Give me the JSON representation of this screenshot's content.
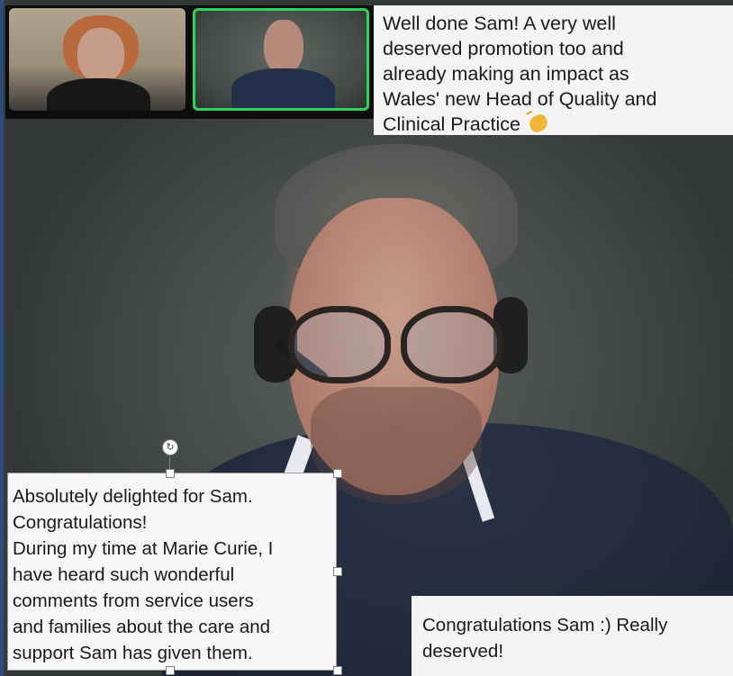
{
  "participants": [
    {
      "name": "",
      "role": "thumbnail"
    },
    {
      "name": "",
      "role": "thumbnail-active-speaker"
    }
  ],
  "colors": {
    "active_speaker_border": "#2fd45a",
    "caption_bg": "#f4f4f4",
    "caption_text": "#1a1a1a"
  },
  "captions": {
    "top_right": {
      "lines": [
        "Well done Sam!  A very well",
        "deserved promotion too and",
        "already making an impact as",
        "Wales' new Head of Quality and",
        "Clinical Practice"
      ],
      "emoji": "clapping-hands"
    },
    "bottom_left": {
      "lines": [
        "Absolutely delighted for Sam.",
        "Congratulations!",
        "During my time at Marie Curie, I",
        "have heard such wonderful",
        "comments from service users",
        "and families about the care and",
        "support Sam has given them."
      ]
    },
    "bottom_right": {
      "lines": [
        "Congratulations Sam :) Really",
        "deserved!"
      ]
    }
  },
  "selection": {
    "rotate_glyph": "↻"
  }
}
